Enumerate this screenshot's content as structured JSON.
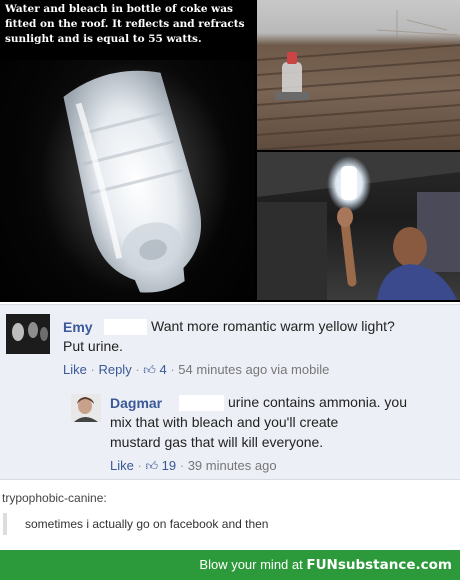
{
  "caption": {
    "text": "Water and bleach in bottle of coke was fitted on the roof. It reflects and refracts sunlight and is equal to 55 watts."
  },
  "comment_1": {
    "author": "Emy",
    "text_line_1": "Want more romantic warm yellow light?",
    "text_line_2": "Put urine.",
    "like_label": "Like",
    "reply_label": "Reply",
    "likes": "4",
    "timestamp": "54 minutes ago via mobile"
  },
  "comment_2": {
    "author": "Dagmar",
    "text_line_1": "urine contains ammonia. you",
    "text_line_2": "mix that with bleach and you'll create",
    "text_line_3": "mustard gas that will kill everyone.",
    "like_label": "Like",
    "likes": "19",
    "timestamp": "39 minutes ago"
  },
  "reblog": {
    "username": "trypophobic-canine:",
    "text": "sometimes i actually go on facebook and then"
  },
  "footer": {
    "prefix": "Blow your mind at",
    "brand": "FUNsubstance.com"
  },
  "colors": {
    "facebook_blue": "#3b5998",
    "comment_bg": "#eceff5",
    "footer_green": "#2c9a3a"
  },
  "icons": {
    "like": "thumbs-up-icon"
  }
}
